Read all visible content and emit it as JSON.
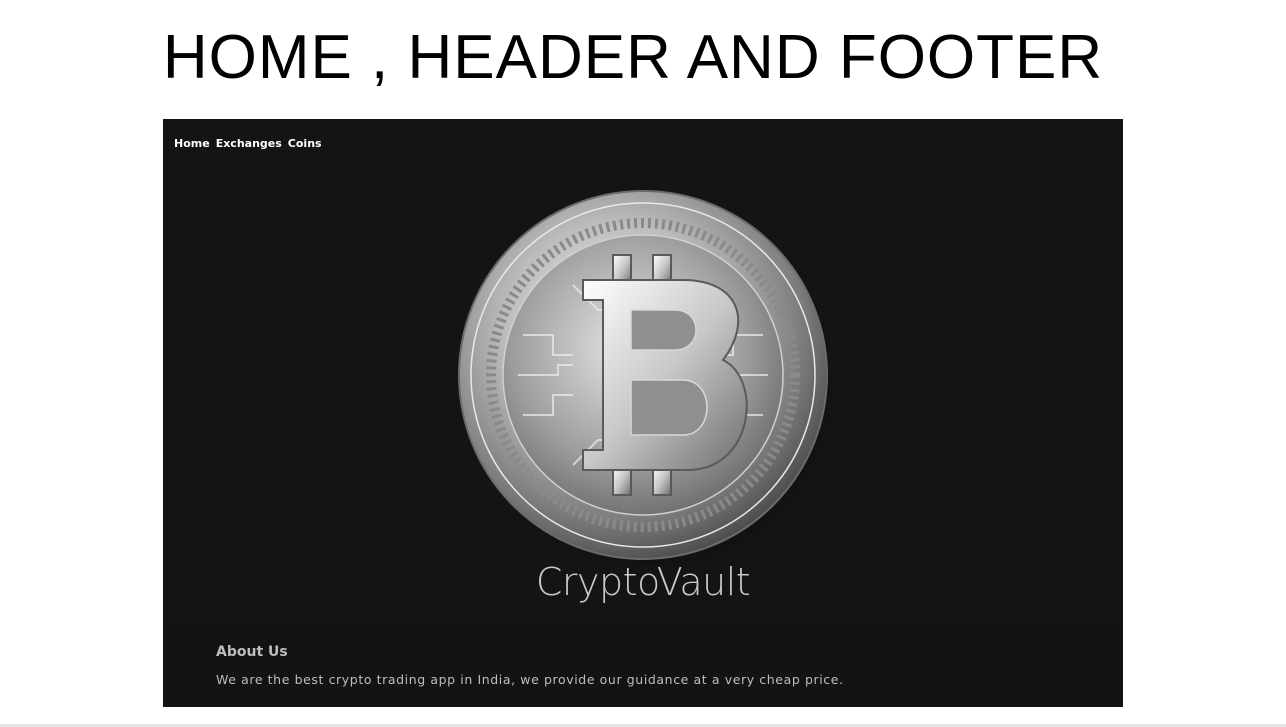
{
  "slide": {
    "title": "HOME , HEADER AND FOOTER"
  },
  "navbar": {
    "items": [
      {
        "label": "Home"
      },
      {
        "label": "Exchanges"
      },
      {
        "label": "Coins"
      }
    ]
  },
  "hero": {
    "image_icon": "bitcoin-coin-icon",
    "brand": "CryptoVault"
  },
  "footer": {
    "heading": "About Us",
    "text": "We are the best crypto trading app in India, we provide our guidance at a very cheap price."
  },
  "colors": {
    "app_background": "#141414",
    "nav_text": "#ffffff",
    "brand_text": "#c9c9c9",
    "footer_text": "#bdbdbd",
    "coin_silver": "#d8d8d8"
  }
}
